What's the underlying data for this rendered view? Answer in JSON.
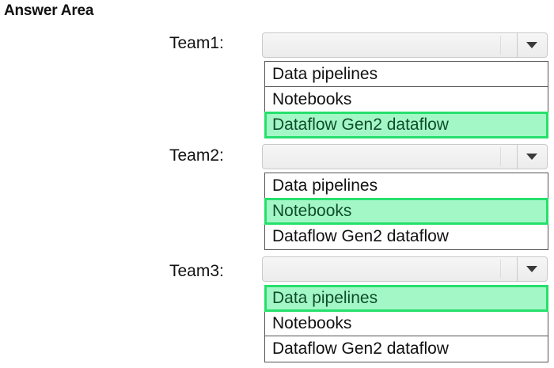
{
  "title": "Answer Area",
  "teams": [
    {
      "label": "Team1:",
      "options": [
        "Data pipelines",
        "Notebooks",
        "Dataflow Gen2 dataflow"
      ],
      "selected_index": 2
    },
    {
      "label": "Team2:",
      "options": [
        "Data pipelines",
        "Notebooks",
        "Dataflow Gen2 dataflow"
      ],
      "selected_index": 1
    },
    {
      "label": "Team3:",
      "options": [
        "Data pipelines",
        "Notebooks",
        "Dataflow Gen2 dataflow"
      ],
      "selected_index": 0
    }
  ],
  "icons": {
    "dropdown": "chevron-down-icon"
  },
  "colors": {
    "selected_fill": "#a3f7c6",
    "selected_border": "#26e06c",
    "selected_text": "#0f4d2c"
  }
}
